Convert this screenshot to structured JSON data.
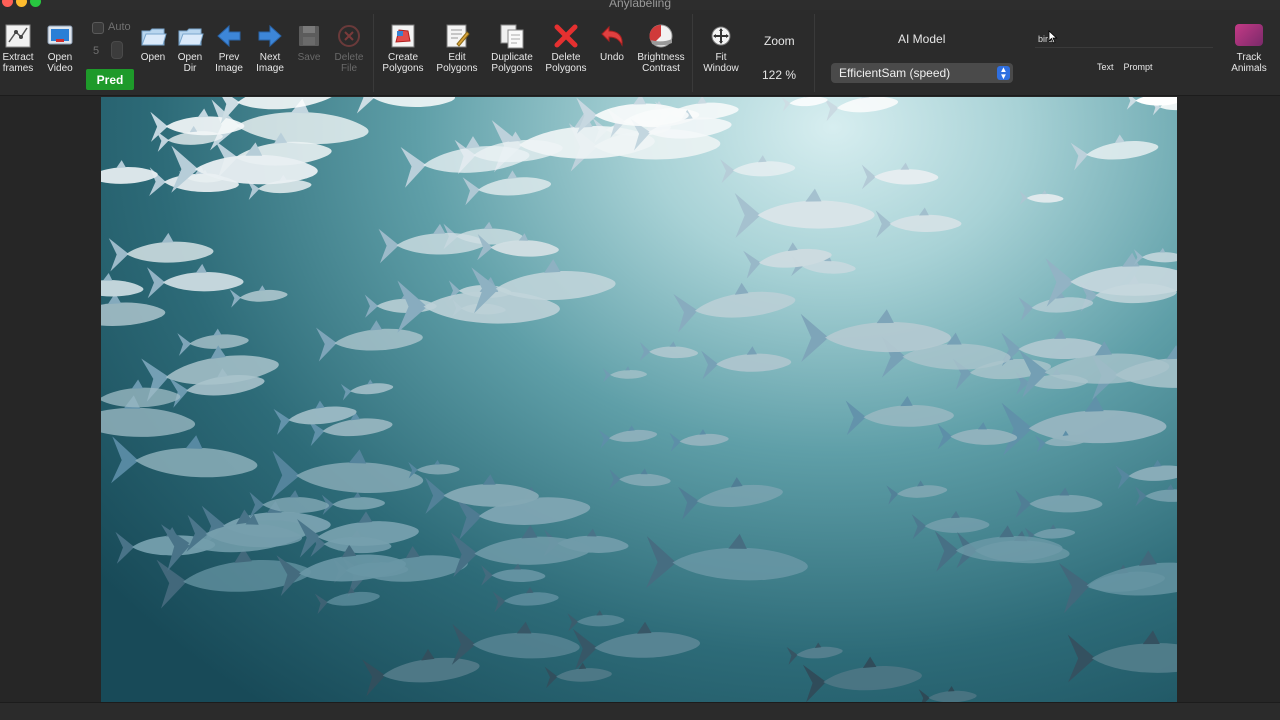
{
  "app": {
    "title": "Anylabeling"
  },
  "toolbar": {
    "extract_frames": "Extract\nframes",
    "open_video": "Open\nVideo",
    "auto_label": "Auto",
    "spin_value": "5",
    "pred_label": "Pred",
    "open": "Open",
    "open_dir": "Open\nDir",
    "prev_image": "Prev\nImage",
    "next_image": "Next\nImage",
    "save": "Save",
    "delete_file": "Delete\nFile",
    "create_polygons": "Create\nPolygons",
    "edit_polygons": "Edit\nPolygons",
    "duplicate_polygons": "Duplicate\nPolygons",
    "delete_polygons": "Delete\nPolygons",
    "undo": "Undo",
    "brightness_contrast": "Brightness\nContrast",
    "fit_window": "Fit\nWindow"
  },
  "zoom": {
    "title": "Zoom",
    "value": "122 %"
  },
  "ai_model": {
    "title": "AI Model",
    "selected": "EfficientSam (speed)"
  },
  "prompt": {
    "value": "bird",
    "text_label": "Text",
    "prompt_label": "Prompt"
  },
  "track": {
    "label": "Track\nAnimals"
  },
  "colors": {
    "pred": "#1e9a2a",
    "delete_red": "#e53030",
    "select_blue": "#2f6fe0"
  }
}
